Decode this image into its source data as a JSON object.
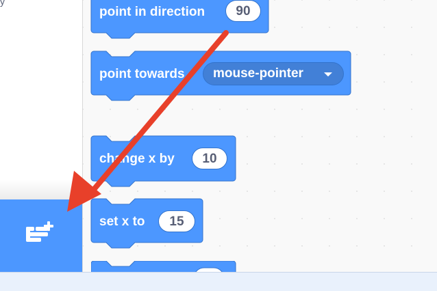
{
  "category_column": {
    "stub_text": "y",
    "extension_button": {
      "icon": "add-extension-icon",
      "color": "#4c97ff"
    }
  },
  "palette": {
    "block_color": "#4c97ff",
    "block_border": "#3373cc",
    "blocks": [
      {
        "label": "point in direction",
        "input_value": "90"
      },
      {
        "label": "point towards",
        "dropdown_value": "mouse-pointer"
      },
      {
        "label": "change x by",
        "input_value": "10"
      },
      {
        "label": "set x to",
        "input_value": "15"
      },
      {
        "label": ""
      }
    ]
  },
  "annotation": {
    "arrow_color": "#e8402a",
    "points_to": "extension-button"
  }
}
